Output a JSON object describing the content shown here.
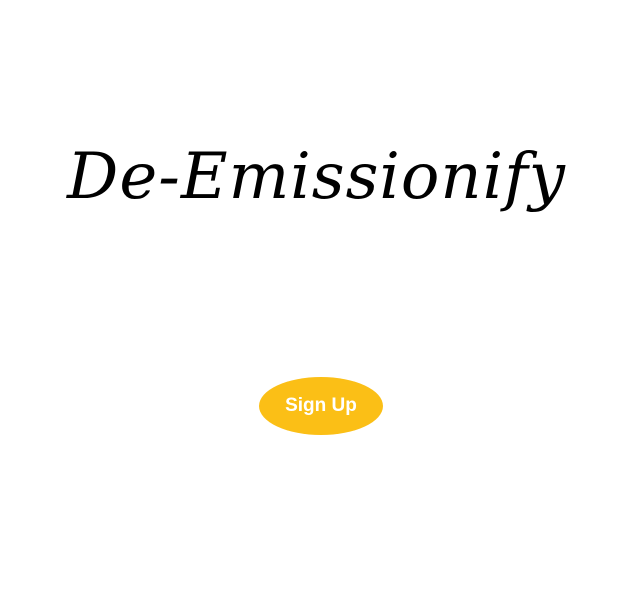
{
  "app": {
    "title": "De-Emissionify"
  },
  "actions": {
    "signup_label": "Sign Up"
  },
  "colors": {
    "background": "#ffffff",
    "title_text": "#000000",
    "button_background": "#fbbf16",
    "button_text": "#ffffff"
  }
}
